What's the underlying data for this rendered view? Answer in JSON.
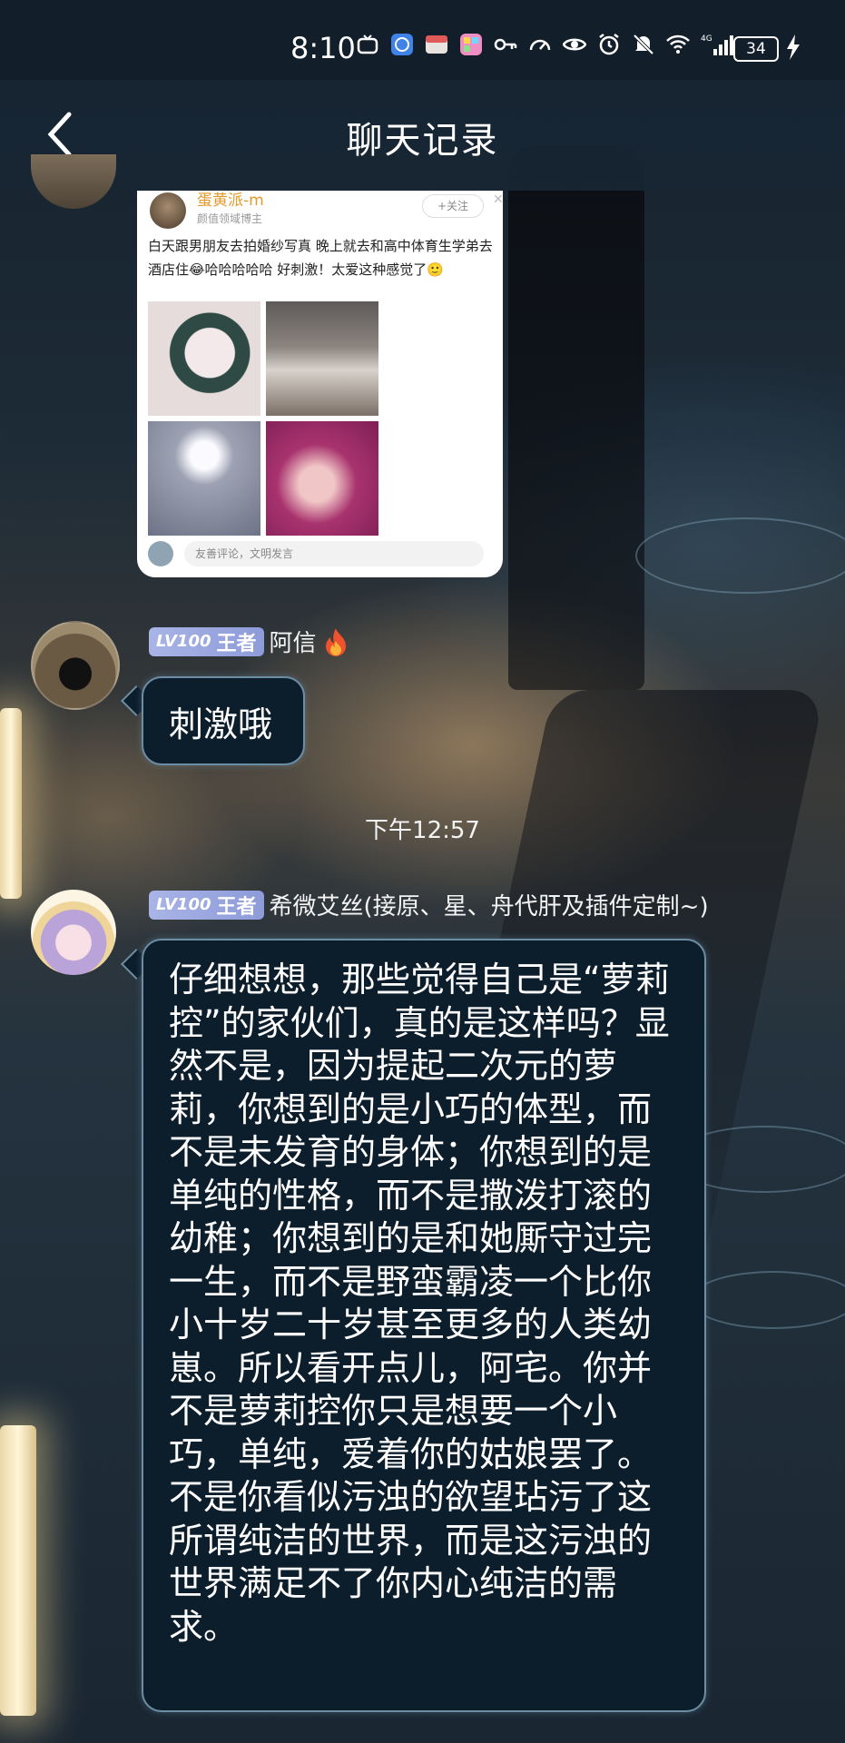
{
  "status_bar": {
    "time": "8:10",
    "battery": "34",
    "icons": [
      "app-icon",
      "browser-icon",
      "bookmark-icon",
      "grid-icon",
      "key-icon",
      "speed-icon",
      "eye-icon",
      "alarm-icon",
      "mute-icon",
      "wifi-icon",
      "4g-signal-icon",
      "charging-icon"
    ]
  },
  "header": {
    "title": "聊天记录",
    "back_icon": "chevron-left-icon"
  },
  "shared_post": {
    "username": "蛋黄派-m",
    "subtitle": "颜值领域博主",
    "follow_label": "+关注",
    "text": "白天跟男朋友去拍婚纱写真 晚上就去和高中体育生学弟去酒店住😂哈哈哈哈哈 好刺激！太爱这种感觉了🙂",
    "comment_placeholder": "友善评论，文明发言"
  },
  "messages": [
    {
      "badge_level": "LV100",
      "badge_title": "王者",
      "nickname": "阿信",
      "text": "刺激哦"
    },
    {
      "badge_level": "LV100",
      "badge_title": "王者",
      "nickname": "希微艾丝(接原、星、舟代肝及插件定制~)",
      "text": "仔细想想，那些觉得自己是“萝莉控”的家伙们，真的是这样吗？显然不是，因为提起二次元的萝莉，你想到的是小巧的体型，而不是未发育的身体；你想到的是单纯的性格，而不是撒泼打滚的幼稚；你想到的是和她厮守过完一生，而不是野蛮霸凌一个比你小十岁二十岁甚至更多的人类幼崽。所以看开点儿，阿宅。你并不是萝莉控你只是想要一个小巧，单纯，爱着你的姑娘罢了。不是你看似污浊的欲望玷污了这所谓纯洁的世界，而是这污浊的世界满足不了你内心纯洁的需求。"
    }
  ],
  "timestamp": "下午12:57",
  "colors": {
    "bubble_bg": "#0c1d2c",
    "bubble_border": "#6d8da3",
    "badge": "#a9b4e6",
    "header_bg": "#182634"
  }
}
